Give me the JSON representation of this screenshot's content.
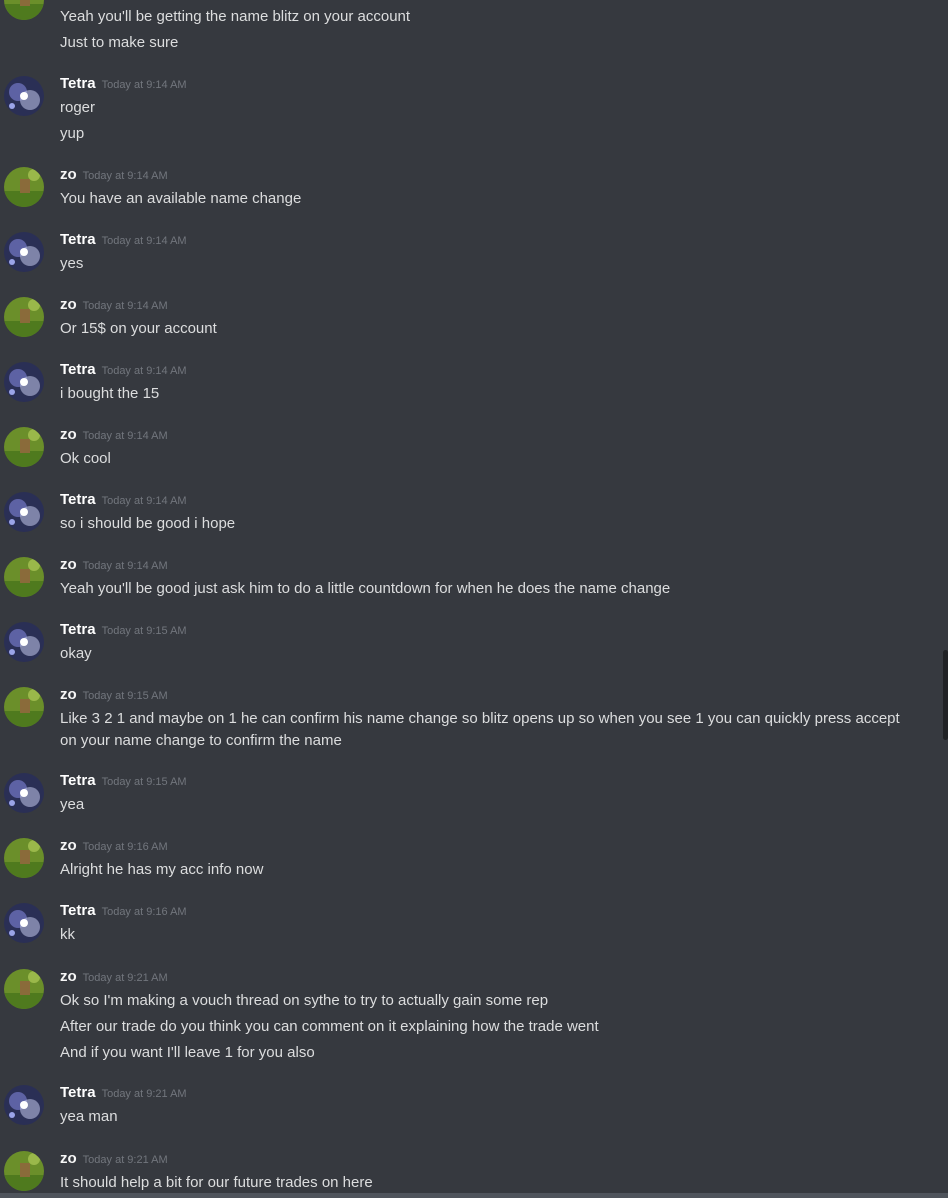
{
  "colors": {
    "background": "#36393f",
    "username": "#ffffff",
    "timestamp": "#72767d",
    "message": "#dcddde"
  },
  "icons": {
    "tetra_avatar": "galaxy-avatar-icon",
    "zo_avatar": "field-avatar-icon"
  },
  "top_group": {
    "lines": [
      "Yeah you'll be getting the name blitz on your account",
      "Just to make sure"
    ]
  },
  "messages": [
    {
      "user": "Tetra",
      "time": "Today at 9:14 AM",
      "lines": [
        "roger",
        "yup"
      ]
    },
    {
      "user": "zo",
      "time": "Today at 9:14 AM",
      "lines": [
        "You have an available name change"
      ]
    },
    {
      "user": "Tetra",
      "time": "Today at 9:14 AM",
      "lines": [
        "yes"
      ]
    },
    {
      "user": "zo",
      "time": "Today at 9:14 AM",
      "lines": [
        "Or 15$ on your account"
      ]
    },
    {
      "user": "Tetra",
      "time": "Today at 9:14 AM",
      "lines": [
        "i bought the 15"
      ]
    },
    {
      "user": "zo",
      "time": "Today at 9:14 AM",
      "lines": [
        "Ok cool"
      ]
    },
    {
      "user": "Tetra",
      "time": "Today at 9:14 AM",
      "lines": [
        "so i should be good i hope"
      ]
    },
    {
      "user": "zo",
      "time": "Today at 9:14 AM",
      "lines": [
        "Yeah you'll be good just ask him to do a little countdown for when he does the name change"
      ]
    },
    {
      "user": "Tetra",
      "time": "Today at 9:15 AM",
      "lines": [
        "okay"
      ]
    },
    {
      "user": "zo",
      "time": "Today at 9:15 AM",
      "lines": [
        "Like 3 2 1 and maybe on 1 he can confirm his name change so blitz opens up so when you see 1 you can quickly press accept on your name change to confirm the name"
      ]
    },
    {
      "user": "Tetra",
      "time": "Today at 9:15 AM",
      "lines": [
        "yea"
      ]
    },
    {
      "user": "zo",
      "time": "Today at 9:16 AM",
      "lines": [
        "Alright he has my acc info now"
      ]
    },
    {
      "user": "Tetra",
      "time": "Today at 9:16 AM",
      "lines": [
        "kk"
      ]
    },
    {
      "user": "zo",
      "time": "Today at 9:21 AM",
      "lines": [
        "Ok so I'm making a vouch thread on sythe to try to actually gain some rep",
        "After our trade do you think you can comment on it explaining how the trade went",
        "And if you want I'll leave 1 for you also"
      ]
    },
    {
      "user": "Tetra",
      "time": "Today at 9:21 AM",
      "lines": [
        "yea man"
      ]
    },
    {
      "user": "zo",
      "time": "Today at 9:21 AM",
      "lines": [
        "It should help a bit for our future trades on here"
      ]
    }
  ]
}
